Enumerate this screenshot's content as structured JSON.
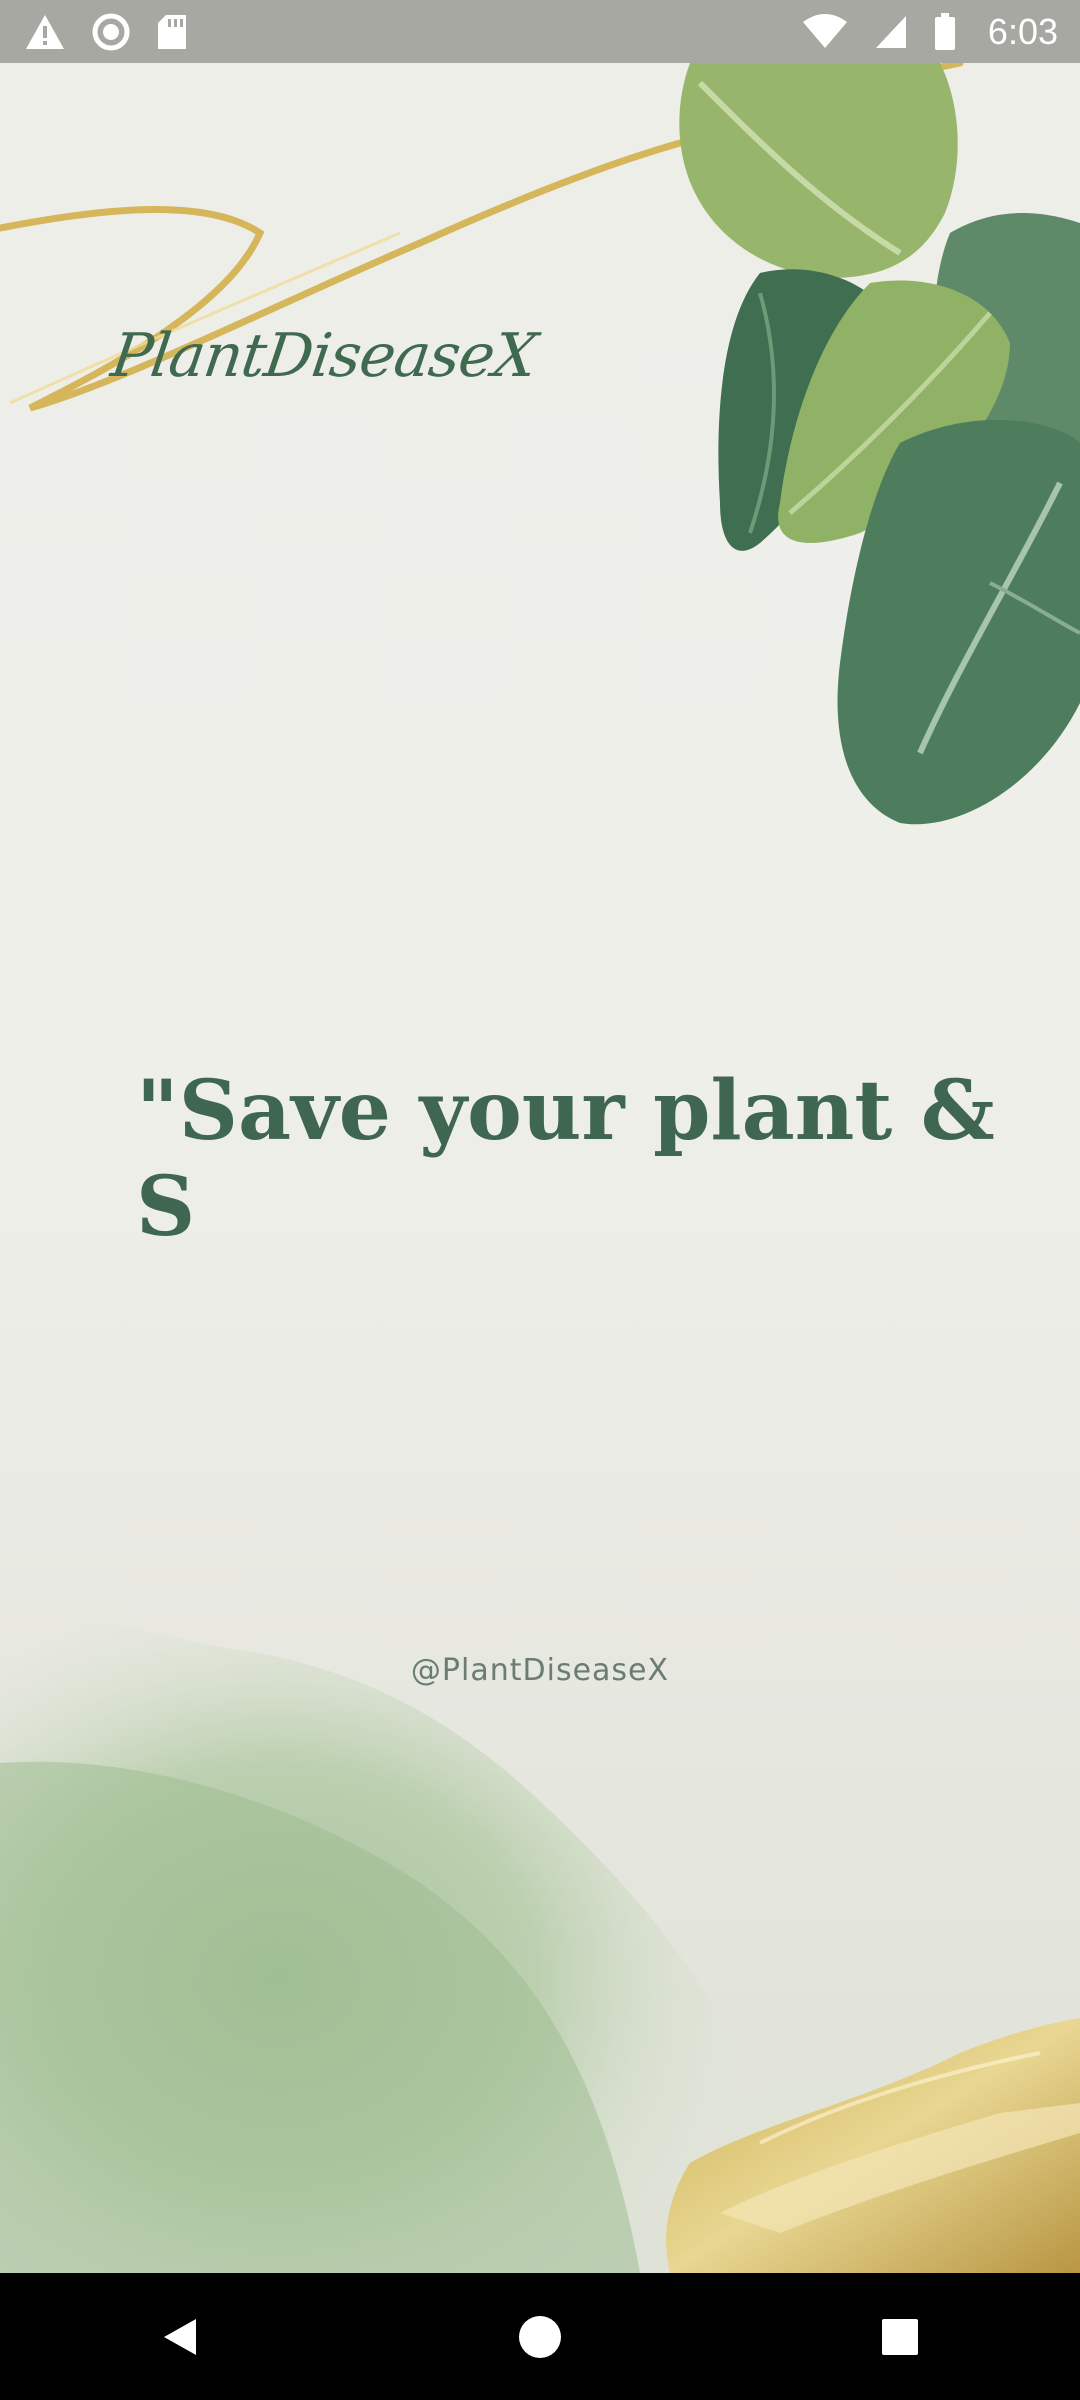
{
  "status_bar": {
    "time": "6:03",
    "icons": [
      "warning-icon",
      "record-icon",
      "sd-card-icon",
      "wifi-icon",
      "signal-icon",
      "battery-icon"
    ]
  },
  "splash": {
    "brand": "PlantDiseaseX",
    "quote": "\"Save your plant &\nS",
    "handle": "@PlantDiseaseX",
    "colors": {
      "text_green": "#3e6650",
      "leaf_dark": "#4f7c61",
      "leaf_light": "#9dbb72",
      "gold": "#d8b85a",
      "wash_green": "#a9c49e"
    }
  },
  "nav_bar": {
    "buttons": [
      "back-icon",
      "home-icon",
      "recents-icon"
    ]
  }
}
